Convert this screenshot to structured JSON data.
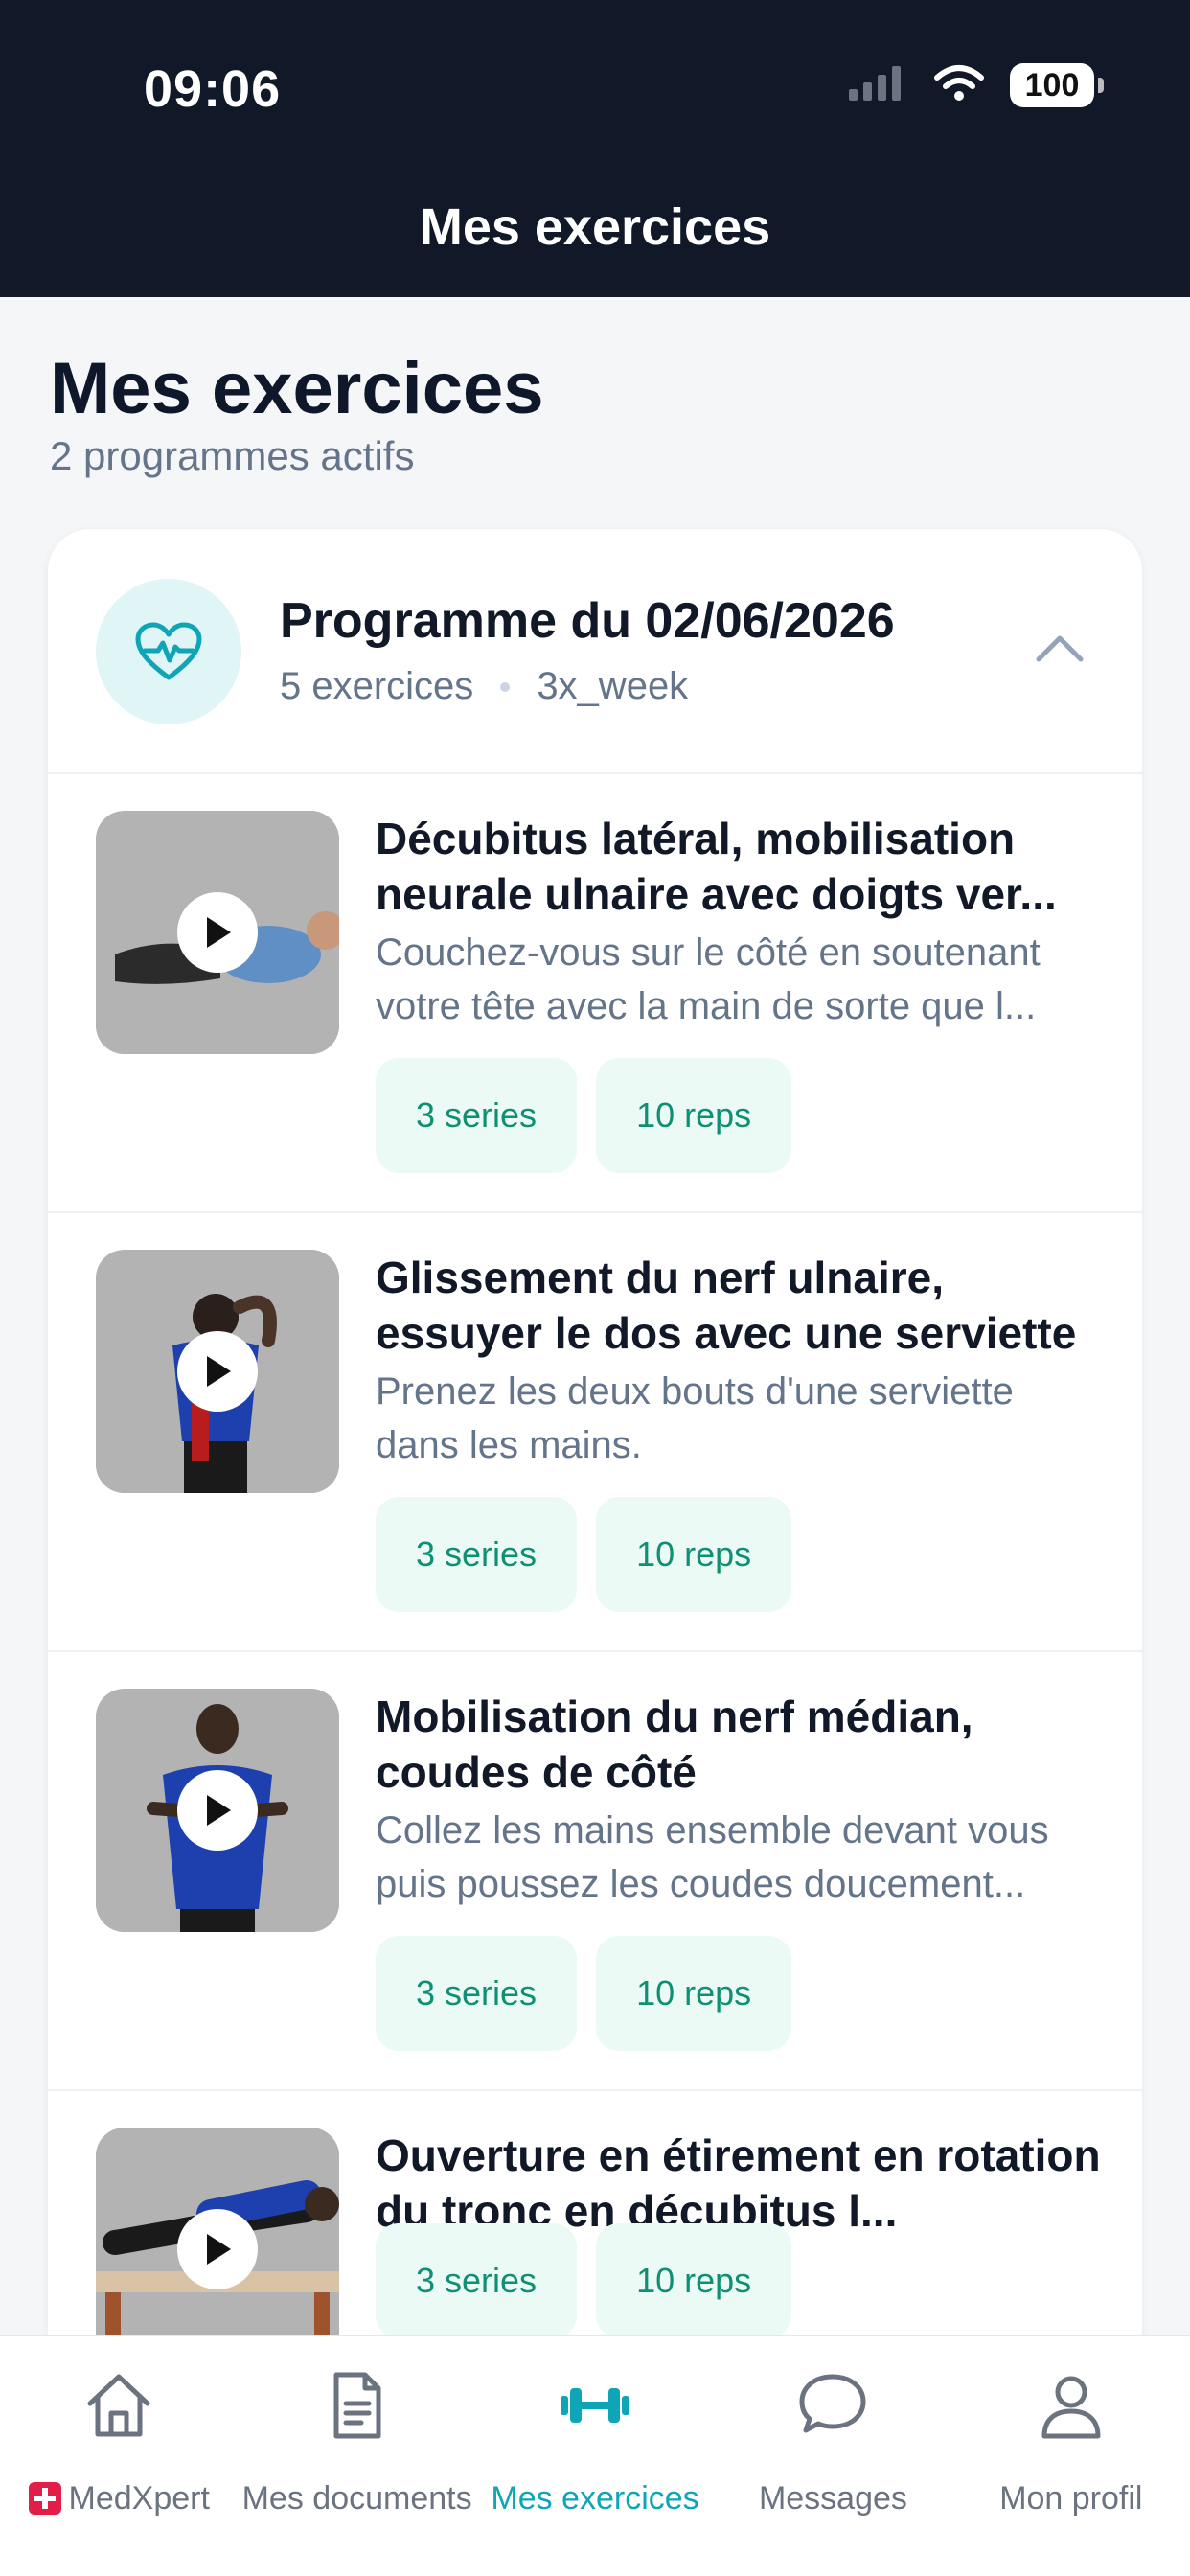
{
  "status_bar": {
    "time": "09:06",
    "battery": "100"
  },
  "header": {
    "title": "Mes exercices"
  },
  "page": {
    "title": "Mes exercices",
    "subtitle": "2 programmes actifs"
  },
  "program": {
    "title": "Programme du 02/06/2026",
    "exercise_count": "5 exercices",
    "frequency": "3x_week",
    "accent_color": "#0ea5b7"
  },
  "exercises": [
    {
      "title": "Décubitus latéral, mobilisation neurale ulnaire avec doigts ver...",
      "description": "Couchez-vous sur le côté en soutenant votre tête avec la main de sorte que l...",
      "series": "3 series",
      "reps": "10 reps"
    },
    {
      "title": "Glissement du nerf ulnaire, essuyer le dos avec une serviette",
      "description": "Prenez les deux bouts d'une serviette dans les mains.",
      "series": "3 series",
      "reps": "10 reps"
    },
    {
      "title": "Mobilisation du nerf médian, coudes de côté",
      "description": "Collez les mains ensemble devant vous puis poussez les coudes doucement...",
      "series": "3 series",
      "reps": "10 reps"
    },
    {
      "title": "Ouverture en étirement en rotation du tronc en décubitus l...",
      "description": "",
      "series": "3 series",
      "reps": "10 reps"
    }
  ],
  "bottom_nav": [
    {
      "label": "MedXpert",
      "icon": "home-icon"
    },
    {
      "label": "Mes documents",
      "icon": "document-icon"
    },
    {
      "label": "Mes exercices",
      "icon": "dumbbell-icon",
      "active": true
    },
    {
      "label": "Messages",
      "icon": "chat-icon"
    },
    {
      "label": "Mon profil",
      "icon": "profile-icon"
    }
  ]
}
